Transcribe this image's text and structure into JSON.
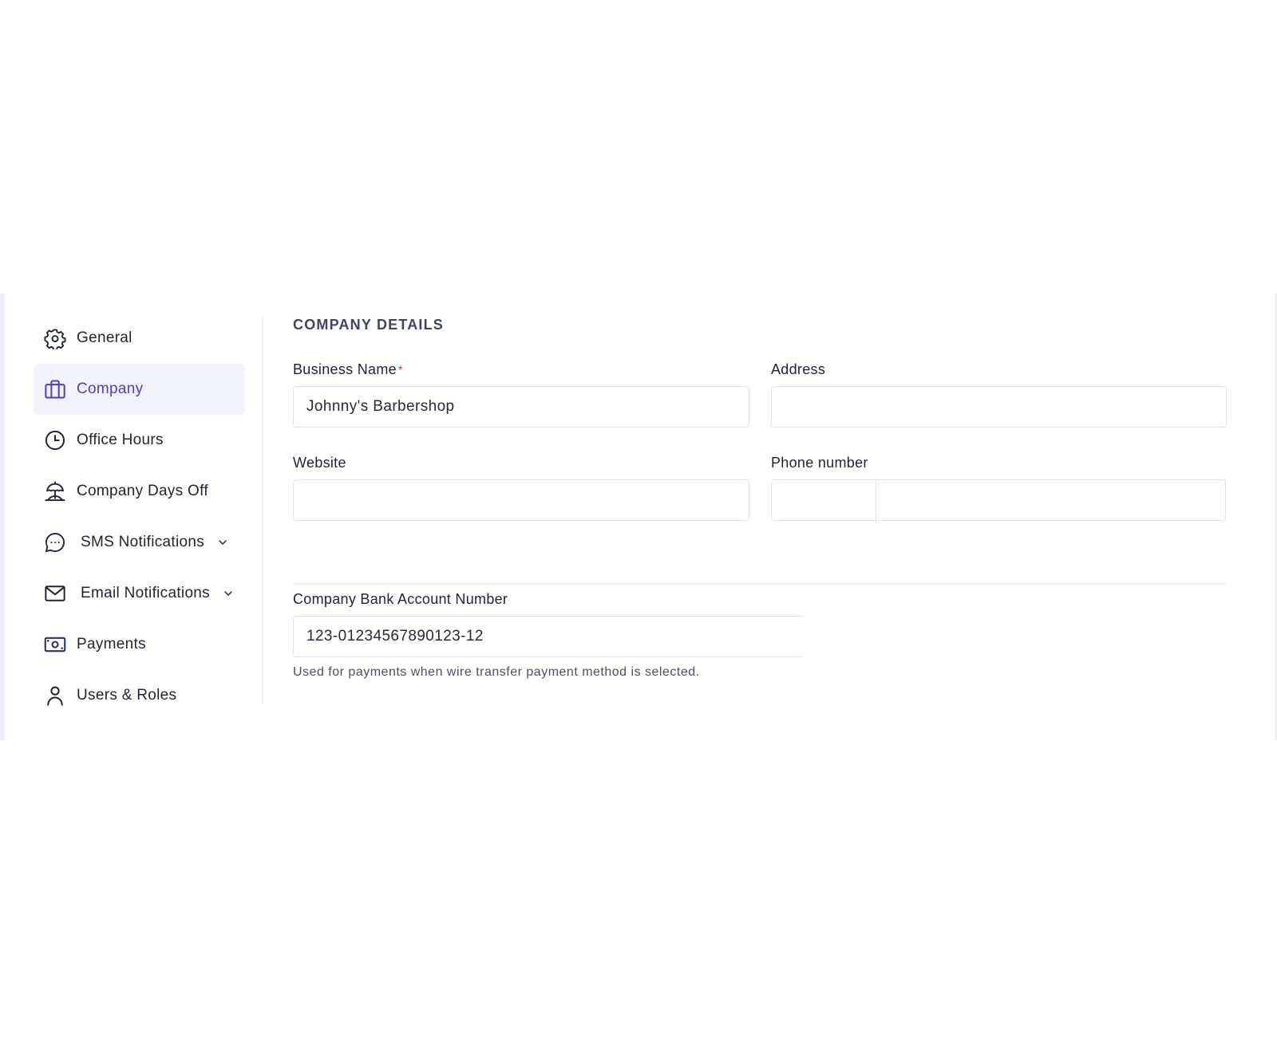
{
  "sidebar": {
    "items": [
      {
        "label": "General",
        "icon": "gear-icon",
        "active": false
      },
      {
        "label": "Company",
        "icon": "briefcase-icon",
        "active": true
      },
      {
        "label": "Office Hours",
        "icon": "clock-icon",
        "active": false
      },
      {
        "label": "Company Days Off",
        "icon": "beach-umbrella-icon",
        "active": false
      },
      {
        "label": "SMS Notifications",
        "icon": "chat-bubble-icon",
        "active": false,
        "expandable": true
      },
      {
        "label": "Email Notifications",
        "icon": "envelope-icon",
        "active": false,
        "expandable": true
      },
      {
        "label": "Payments",
        "icon": "banknote-icon",
        "active": false
      },
      {
        "label": "Users & Roles",
        "icon": "user-icon",
        "active": false
      }
    ]
  },
  "main": {
    "section_title": "COMPANY DETAILS",
    "business_name": {
      "label": "Business Name",
      "required_mark": "*",
      "value": "Johnny's Barbershop"
    },
    "address": {
      "label": "Address",
      "value": ""
    },
    "website": {
      "label": "Website",
      "value": ""
    },
    "phone": {
      "label": "Phone number",
      "value": ""
    },
    "bank_account": {
      "label": "Company Bank Account Number",
      "value": "123-01234567890123-12",
      "help": "Used for payments when wire transfer payment method is selected."
    }
  },
  "colors": {
    "accent": "#4a3fc4",
    "active_bg": "#f1f3fd",
    "required": "#e0245e",
    "text": "#1f2337"
  }
}
